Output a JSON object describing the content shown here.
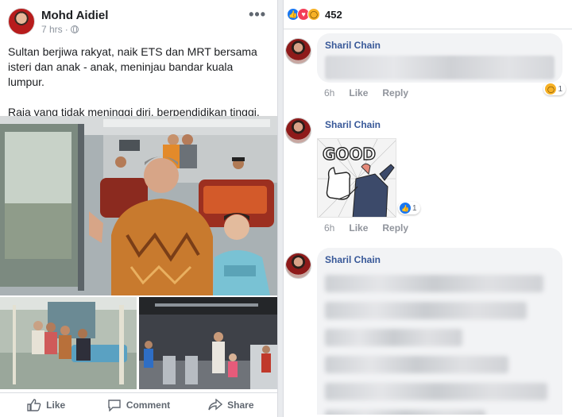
{
  "post": {
    "author": "Mohd Aidiel",
    "time": "7 hrs",
    "meta_sep": "·",
    "more": "•••",
    "text_p1": "Sultan berjiwa rakyat, naik ETS dan MRT bersama isteri dan anak - anak, meninjau bandar kuala lumpur.",
    "text_p2": "Raja yang tidak meninggi diri, berpendidikan tinggi, seharusnya ditabalkan sebagai YDPA yang baru.",
    "actions": {
      "like": "Like",
      "comment": "Comment",
      "share": "Share"
    }
  },
  "reactions": {
    "count": "452",
    "types": [
      "like-icon",
      "love-icon",
      "wow-icon"
    ]
  },
  "comments": [
    {
      "name": "Sharil Chain",
      "time": "6h",
      "like": "Like",
      "reply": "Reply",
      "reaction_count": "1"
    },
    {
      "name": "Sharil Chain",
      "time": "6h",
      "like": "Like",
      "reply": "Reply",
      "reaction_count": "1",
      "sticker_text": "GOOD"
    },
    {
      "name": "Sharil Chain"
    }
  ],
  "colors": {
    "link": "#385898",
    "like_blue": "#1877f2",
    "love_red": "#f33e58",
    "wow_yellow": "#f7b125"
  }
}
